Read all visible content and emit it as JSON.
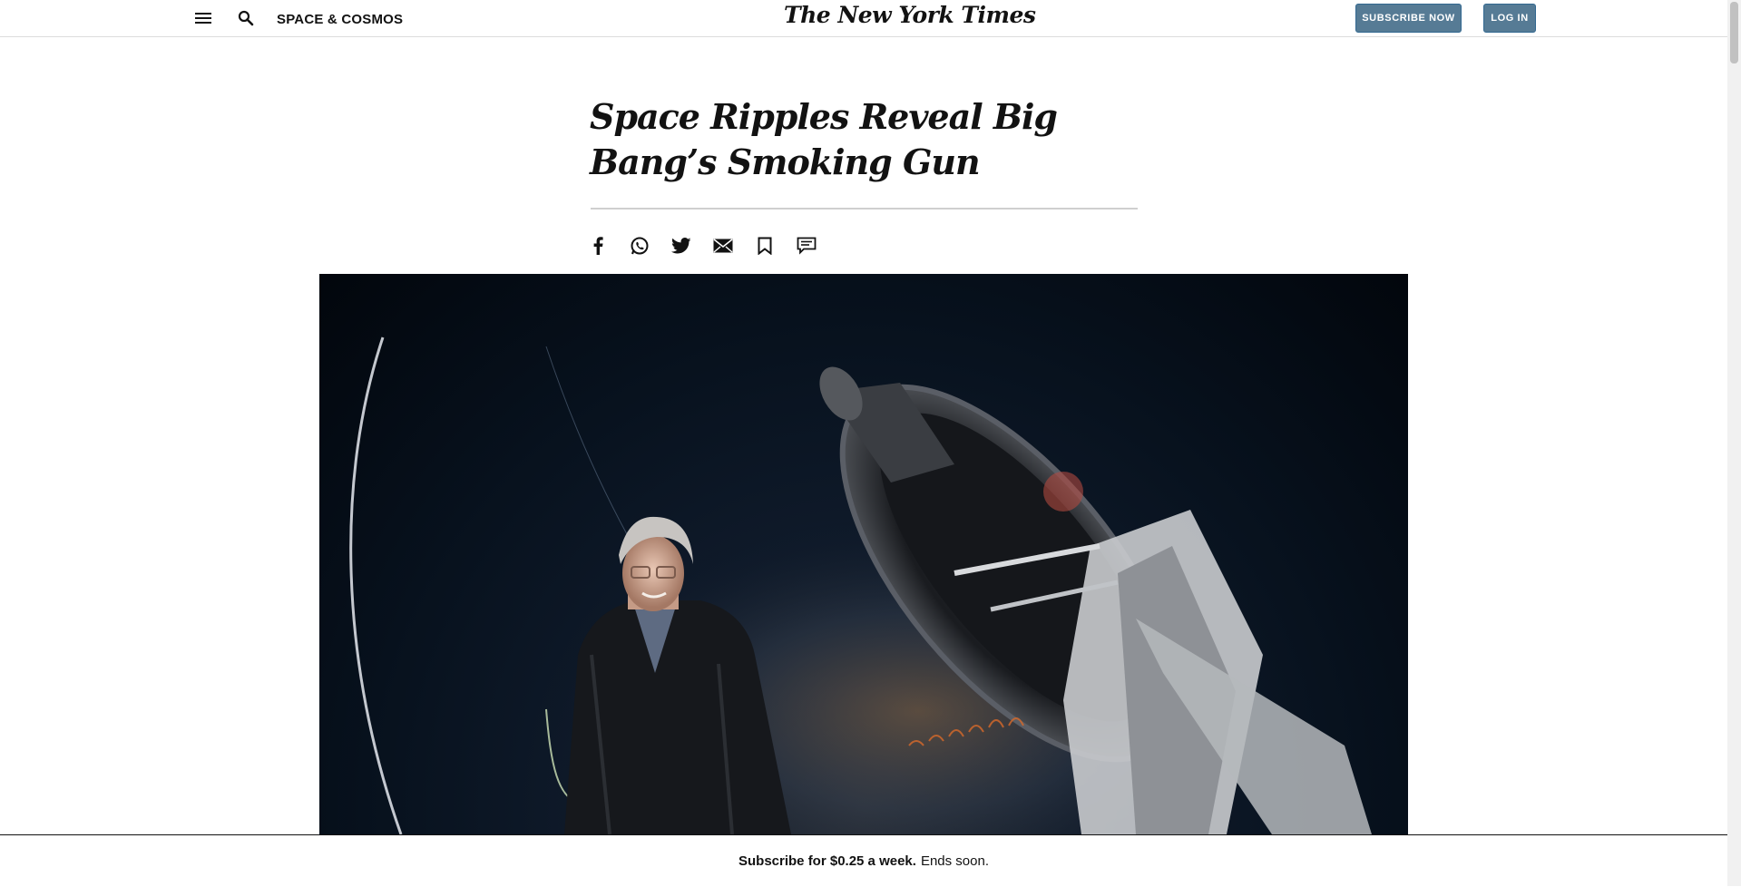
{
  "header": {
    "menu_icon": "hamburger-menu-icon",
    "search_icon": "search-icon",
    "section_label": "SPACE & COSMOS",
    "logo_text": "The New York Times",
    "subscribe_label": "SUBSCRIBE NOW",
    "login_label": "LOG IN",
    "button_color": "#567b95"
  },
  "article": {
    "headline": "Space Ripples Reveal Big Bang’s Smoking Gun",
    "share_icons": [
      "facebook-icon",
      "whatsapp-icon",
      "twitter-icon",
      "email-icon",
      "bookmark-icon",
      "comment-icon"
    ]
  },
  "hero": {
    "description_icon": "telescope-photo"
  },
  "banner": {
    "offer_bold": "Subscribe for $0.25 a week.",
    "offer_rest": "Ends soon."
  }
}
